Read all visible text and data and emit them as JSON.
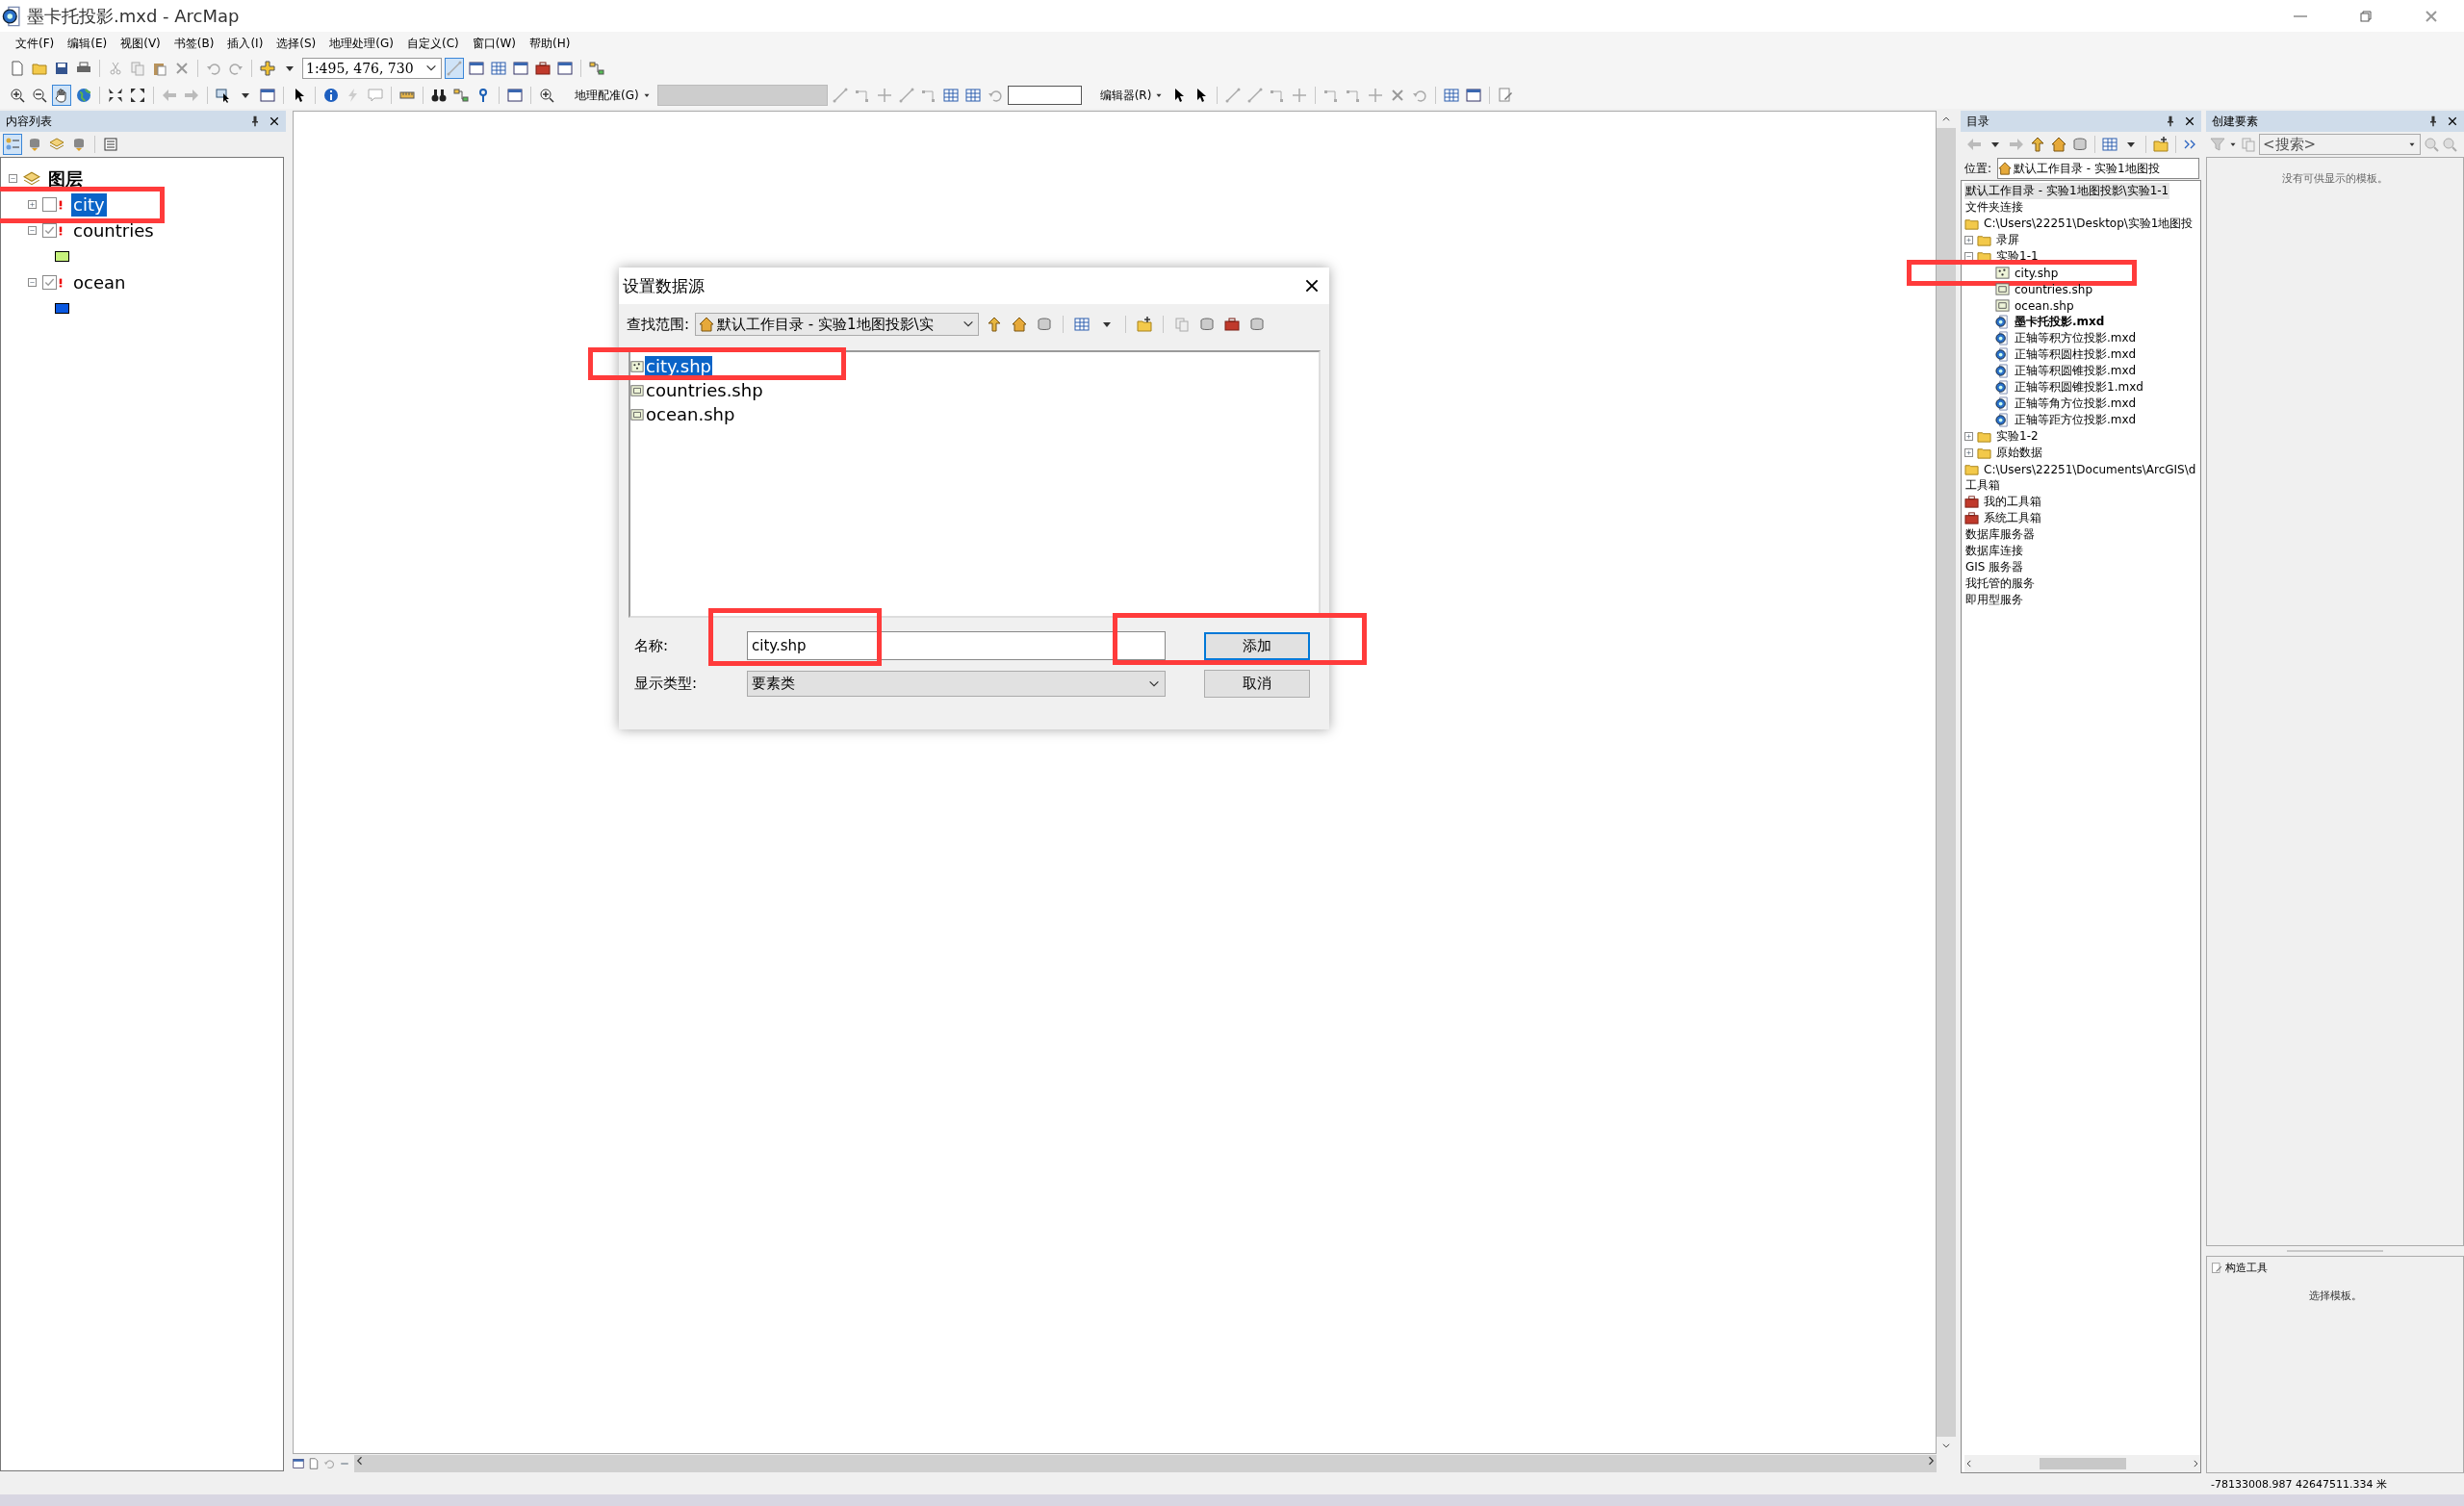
{
  "window": {
    "title": "墨卡托投影.mxd - ArcMap"
  },
  "menu": [
    {
      "label": "文件(F)"
    },
    {
      "label": "编辑(E)"
    },
    {
      "label": "视图(V)"
    },
    {
      "label": "书签(B)"
    },
    {
      "label": "插入(I)"
    },
    {
      "label": "选择(S)"
    },
    {
      "label": "地理处理(G)"
    },
    {
      "label": "自定义(C)"
    },
    {
      "label": "窗口(W)"
    },
    {
      "label": "帮助(H)"
    }
  ],
  "toolbar": {
    "scale": "1:495, 476, 730",
    "georef_label": "地理配准(G)",
    "editor_label": "编辑器(R)"
  },
  "toc": {
    "title": "内容列表",
    "root": {
      "label": "图层",
      "expanded": true,
      "children": [
        {
          "label": "city",
          "checked": false,
          "expanded": false,
          "selected": true,
          "broken": true,
          "marked": true
        },
        {
          "label": "countries",
          "checked": true,
          "expanded": true,
          "selected": false,
          "broken": true,
          "marked": false,
          "color": "#c6f27c"
        },
        {
          "label": "ocean",
          "checked": true,
          "expanded": true,
          "selected": false,
          "broken": true,
          "marked": false,
          "color": "#0a58e0"
        }
      ]
    }
  },
  "dialog": {
    "title": "设置数据源",
    "look_in_label": "查找范围:",
    "look_in": "默认工作目录 - 实验1地图投影\\实",
    "files": [
      {
        "name": "city.shp",
        "kind": "point",
        "selected": true,
        "marked": true
      },
      {
        "name": "countries.shp",
        "kind": "polygon",
        "selected": false,
        "marked": false
      },
      {
        "name": "ocean.shp",
        "kind": "polygon",
        "selected": false,
        "marked": false
      }
    ],
    "name_label": "名称:",
    "name_value": "city.shp",
    "name_marked": true,
    "type_label": "显示类型:",
    "type_value": "要素类",
    "buttons": [
      {
        "label": "添加",
        "kind": "primary",
        "marked": true
      },
      {
        "label": "取消",
        "kind": "normal",
        "marked": false
      }
    ]
  },
  "catalog": {
    "title": "目录",
    "location_label": "位置:",
    "location": "默认工作目录 - 实验1地图投",
    "items": [
      {
        "label": "默认工作目录 - 实验1地图投影\\实验1-1",
        "kind": "heading",
        "selected": true
      },
      {
        "label": "文件夹连接",
        "kind": "heading",
        "selected": false
      },
      {
        "label": "C:\\Users\\22251\\Desktop\\实验1地图投",
        "kind": "connection",
        "selected": false,
        "children": [
          {
            "label": "录屏",
            "kind": "folder",
            "expanded": false,
            "selected": false
          },
          {
            "label": "实验1-1",
            "kind": "folder",
            "expanded": true,
            "selected": false,
            "children": [
              {
                "label": "city.shp",
                "kind": "point",
                "selected": false,
                "marked": true
              },
              {
                "label": "countries.shp",
                "kind": "polygon",
                "selected": false
              },
              {
                "label": "ocean.shp",
                "kind": "polygon",
                "selected": false
              },
              {
                "label": "墨卡托投影.mxd",
                "kind": "map",
                "current": true,
                "selected": false
              },
              {
                "label": "正轴等积方位投影.mxd",
                "kind": "map",
                "current": false,
                "selected": false
              },
              {
                "label": "正轴等积圆柱投影.mxd",
                "kind": "map",
                "current": false,
                "selected": false
              },
              {
                "label": "正轴等积圆锥投影.mxd",
                "kind": "map",
                "current": false,
                "selected": false
              },
              {
                "label": "正轴等积圆锥投影1.mxd",
                "kind": "map",
                "current": false,
                "selected": false
              },
              {
                "label": "正轴等角方位投影.mxd",
                "kind": "map",
                "current": false,
                "selected": false
              },
              {
                "label": "正轴等距方位投影.mxd",
                "kind": "map",
                "current": false,
                "selected": false
              }
            ]
          },
          {
            "label": "实验1-2",
            "kind": "folder",
            "expanded": false,
            "selected": false
          },
          {
            "label": "原始数据",
            "kind": "folder",
            "expanded": false,
            "selected": false
          }
        ]
      },
      {
        "label": "C:\\Users\\22251\\Documents\\ArcGIS\\d",
        "kind": "connection",
        "selected": false
      },
      {
        "label": "工具箱",
        "kind": "heading",
        "selected": false
      },
      {
        "label": "我的工具箱",
        "kind": "toolbox",
        "selected": false
      },
      {
        "label": "系统工具箱",
        "kind": "toolbox",
        "selected": false
      },
      {
        "label": "数据库服务器",
        "kind": "heading",
        "selected": false
      },
      {
        "label": "数据库连接",
        "kind": "heading",
        "selected": false
      },
      {
        "label": "GIS 服务器",
        "kind": "heading",
        "selected": false
      },
      {
        "label": "我托管的服务",
        "kind": "heading",
        "selected": false
      },
      {
        "label": "即用型服务",
        "kind": "heading",
        "selected": false
      }
    ]
  },
  "create_features": {
    "title": "创建要素",
    "search_placeholder": "<搜索>",
    "empty_text": "没有可供显示的模板。",
    "tools_title": "构造工具",
    "tools_hint": "选择模板。"
  },
  "status_bar": {
    "coordinates": "-78133008.987  42647511.334 米"
  }
}
